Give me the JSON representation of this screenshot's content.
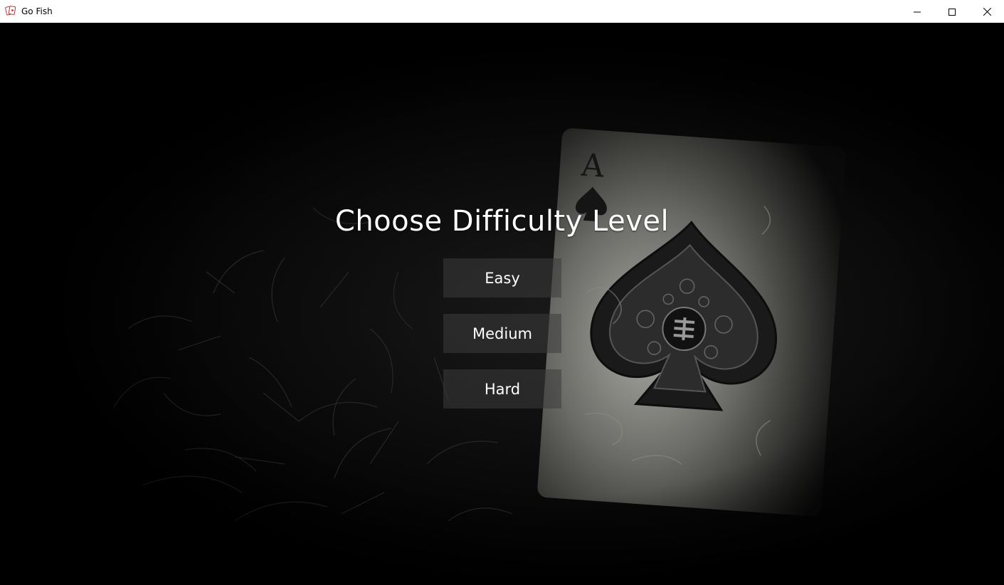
{
  "window": {
    "title": "Go Fish",
    "controls": {
      "minimize_icon": "minimize-icon",
      "maximize_icon": "maximize-icon",
      "close_icon": "close-icon"
    }
  },
  "menu": {
    "heading": "Choose Difficulty Level",
    "options": [
      {
        "label": "Easy"
      },
      {
        "label": "Medium"
      },
      {
        "label": "Hard"
      }
    ]
  },
  "background": {
    "card_rank": "A",
    "card_suit": "spade"
  },
  "colors": {
    "background": "#000000",
    "text": "#ffffff",
    "button": "#3c3c3c",
    "titlebar": "#ffffff"
  }
}
